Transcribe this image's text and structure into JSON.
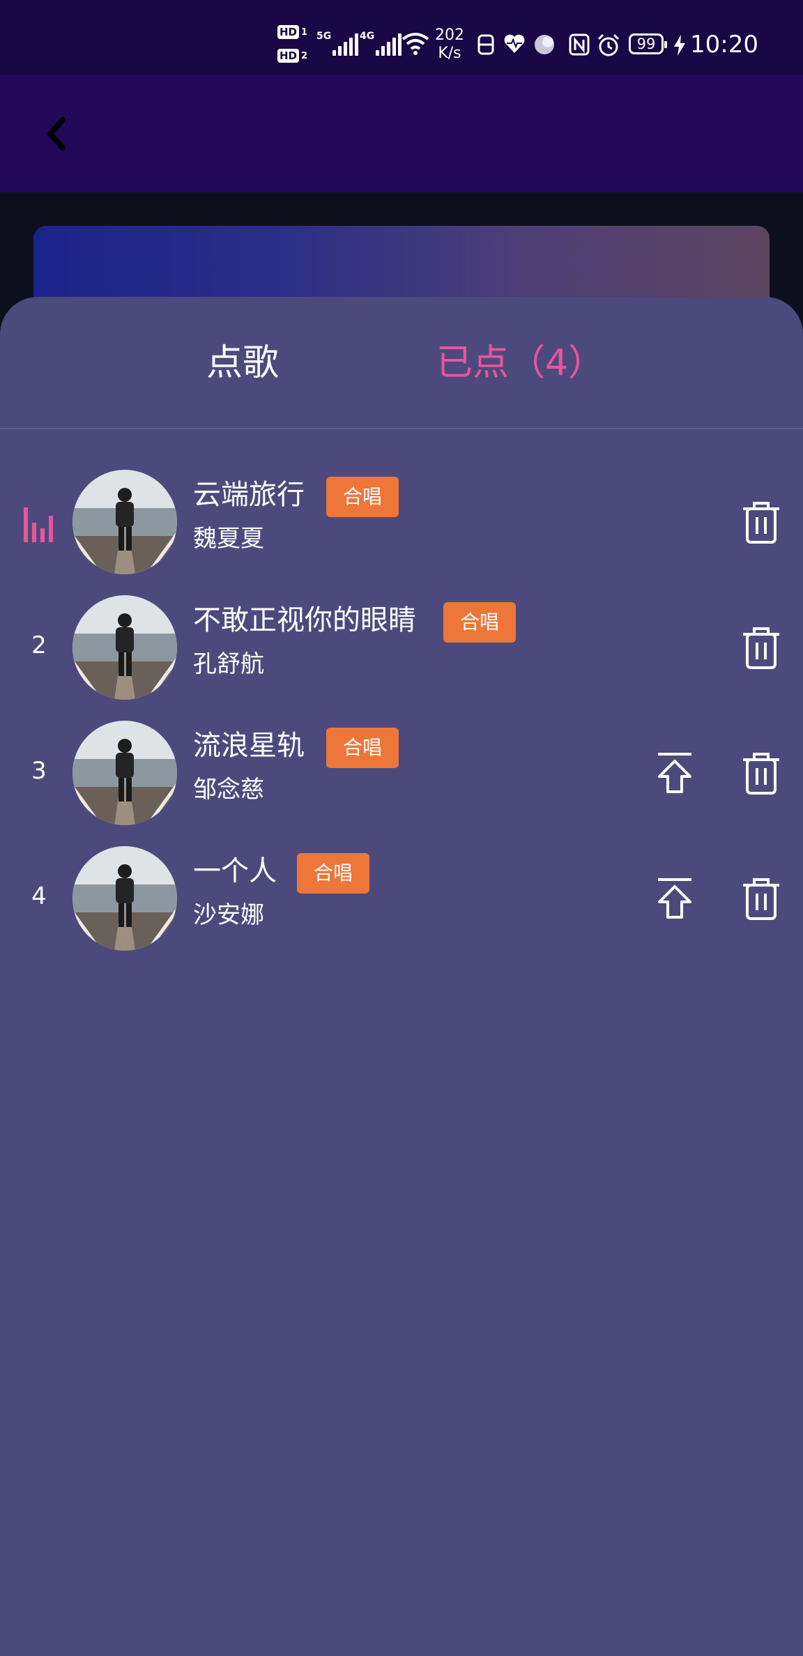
{
  "status_bar": {
    "hd1": "HD",
    "hd1_sub": "1",
    "hd2": "HD",
    "hd2_sub": "2",
    "net1": "5G",
    "net2": "4G",
    "speed_value": "202",
    "speed_unit": "K/s",
    "battery": "99",
    "time": "10:20"
  },
  "tabs": {
    "order_song": "点歌",
    "ordered": "已点（4）"
  },
  "colors": {
    "sheet_bg": "#4c4a7d",
    "active_tab": "#e8559b",
    "badge_bg": "#ee7638",
    "status_bar_bg": "#190746",
    "app_bar_bg": "#230759"
  },
  "songs": [
    {
      "index": "",
      "playing": true,
      "title": "云端旅行",
      "tag": "合唱",
      "artist": "魏夏夏",
      "show_top": false
    },
    {
      "index": "2",
      "playing": false,
      "title": "不敢正视你的眼睛",
      "tag": "合唱",
      "artist": "孔舒航",
      "show_top": false
    },
    {
      "index": "3",
      "playing": false,
      "title": "流浪星轨",
      "tag": "合唱",
      "artist": "邹念慈",
      "show_top": true
    },
    {
      "index": "4",
      "playing": false,
      "title": "一个人",
      "tag": "合唱",
      "artist": "沙安娜",
      "show_top": true
    }
  ],
  "icons": {
    "back": "chevron-left-icon",
    "playing": "equalizer-icon",
    "move_top": "move-to-top-icon",
    "delete": "trash-icon"
  }
}
